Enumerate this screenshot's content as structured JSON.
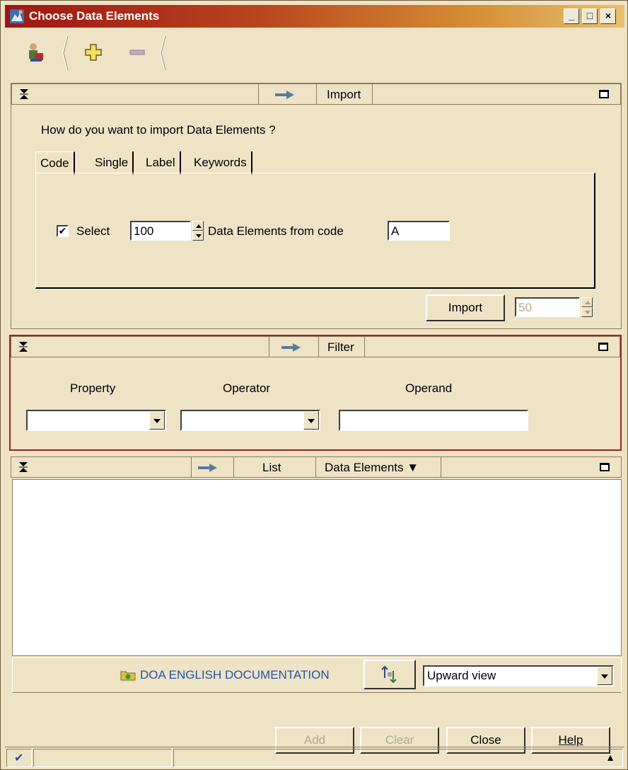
{
  "window": {
    "title": "Choose Data Elements",
    "controls": {
      "minimize": "_",
      "maximize": "□",
      "close": "×"
    }
  },
  "toolbar": {
    "buttons": [
      {
        "icon": "users-icon"
      },
      {
        "icon": "plus-icon"
      },
      {
        "icon": "minus-icon"
      }
    ]
  },
  "import_panel": {
    "header": "Import",
    "question": "How do you want to import Data Elements  ?",
    "tabs": [
      "Code",
      "Single",
      "Label",
      "Keywords"
    ],
    "active_tab": "Code",
    "select_checked": true,
    "select_label": "Select",
    "count_value": "100",
    "middle_label": "Data Elements  from code",
    "code_value": "A",
    "import_button": "Import",
    "batch_value": "50"
  },
  "filter_panel": {
    "header": "Filter",
    "columns": {
      "property": "Property",
      "operator": "Operator",
      "operand": "Operand"
    },
    "property_value": "",
    "operator_value": "",
    "operand_value": ""
  },
  "list_panel": {
    "header": "List",
    "dropdown_label": "Data Elements ▼",
    "documentation_link": "DOA ENGLISH DOCUMENTATION",
    "view_value": "Upward view"
  },
  "actions": {
    "add": "Add",
    "clear": "Clear",
    "close": "Close",
    "help": "Help"
  },
  "status": {
    "ok_glyph": "✔",
    "up_glyph": "▲"
  },
  "colors": {
    "title_start": "#9e1712",
    "title_end": "#e8c070",
    "background": "#efe3c6",
    "filter_border": "#8e2a2a",
    "link": "#2255aa"
  }
}
